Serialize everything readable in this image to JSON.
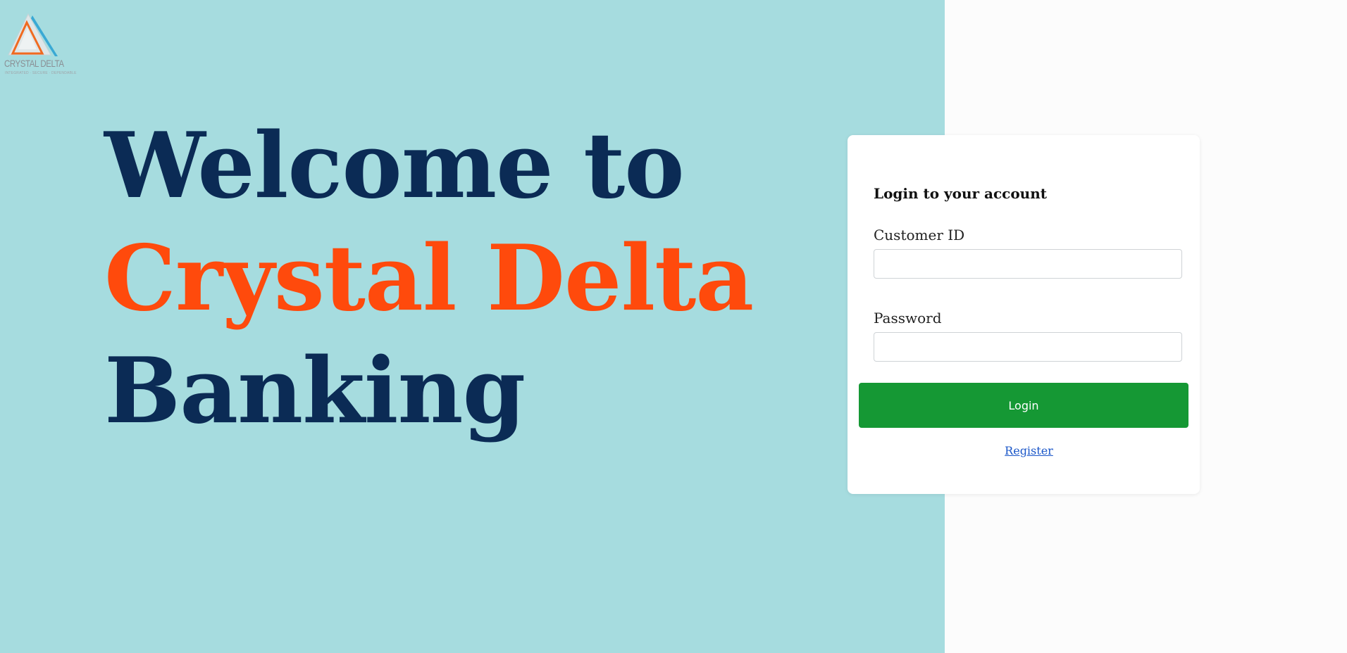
{
  "brand": {
    "logo_name": "CRYSTAL DELTA",
    "logo_tagline": "INTEGRATED · SECURE · DEPENDABLE",
    "colors": {
      "navy": "#0b2b55",
      "orange": "#ff4a0c",
      "hero_bg": "#a6dcdf",
      "login_green": "#159834",
      "link_blue": "#1a56c8"
    }
  },
  "hero": {
    "line1": "Welcome to",
    "line2": "Crystal Delta",
    "line3": "Banking"
  },
  "login": {
    "title": "Login to your account",
    "customer_id_label": "Customer ID",
    "customer_id_value": "",
    "password_label": "Password",
    "password_value": "",
    "submit_label": "Login",
    "register_link": "Register"
  },
  "icons": {
    "logo": "triangle-logo-icon"
  }
}
